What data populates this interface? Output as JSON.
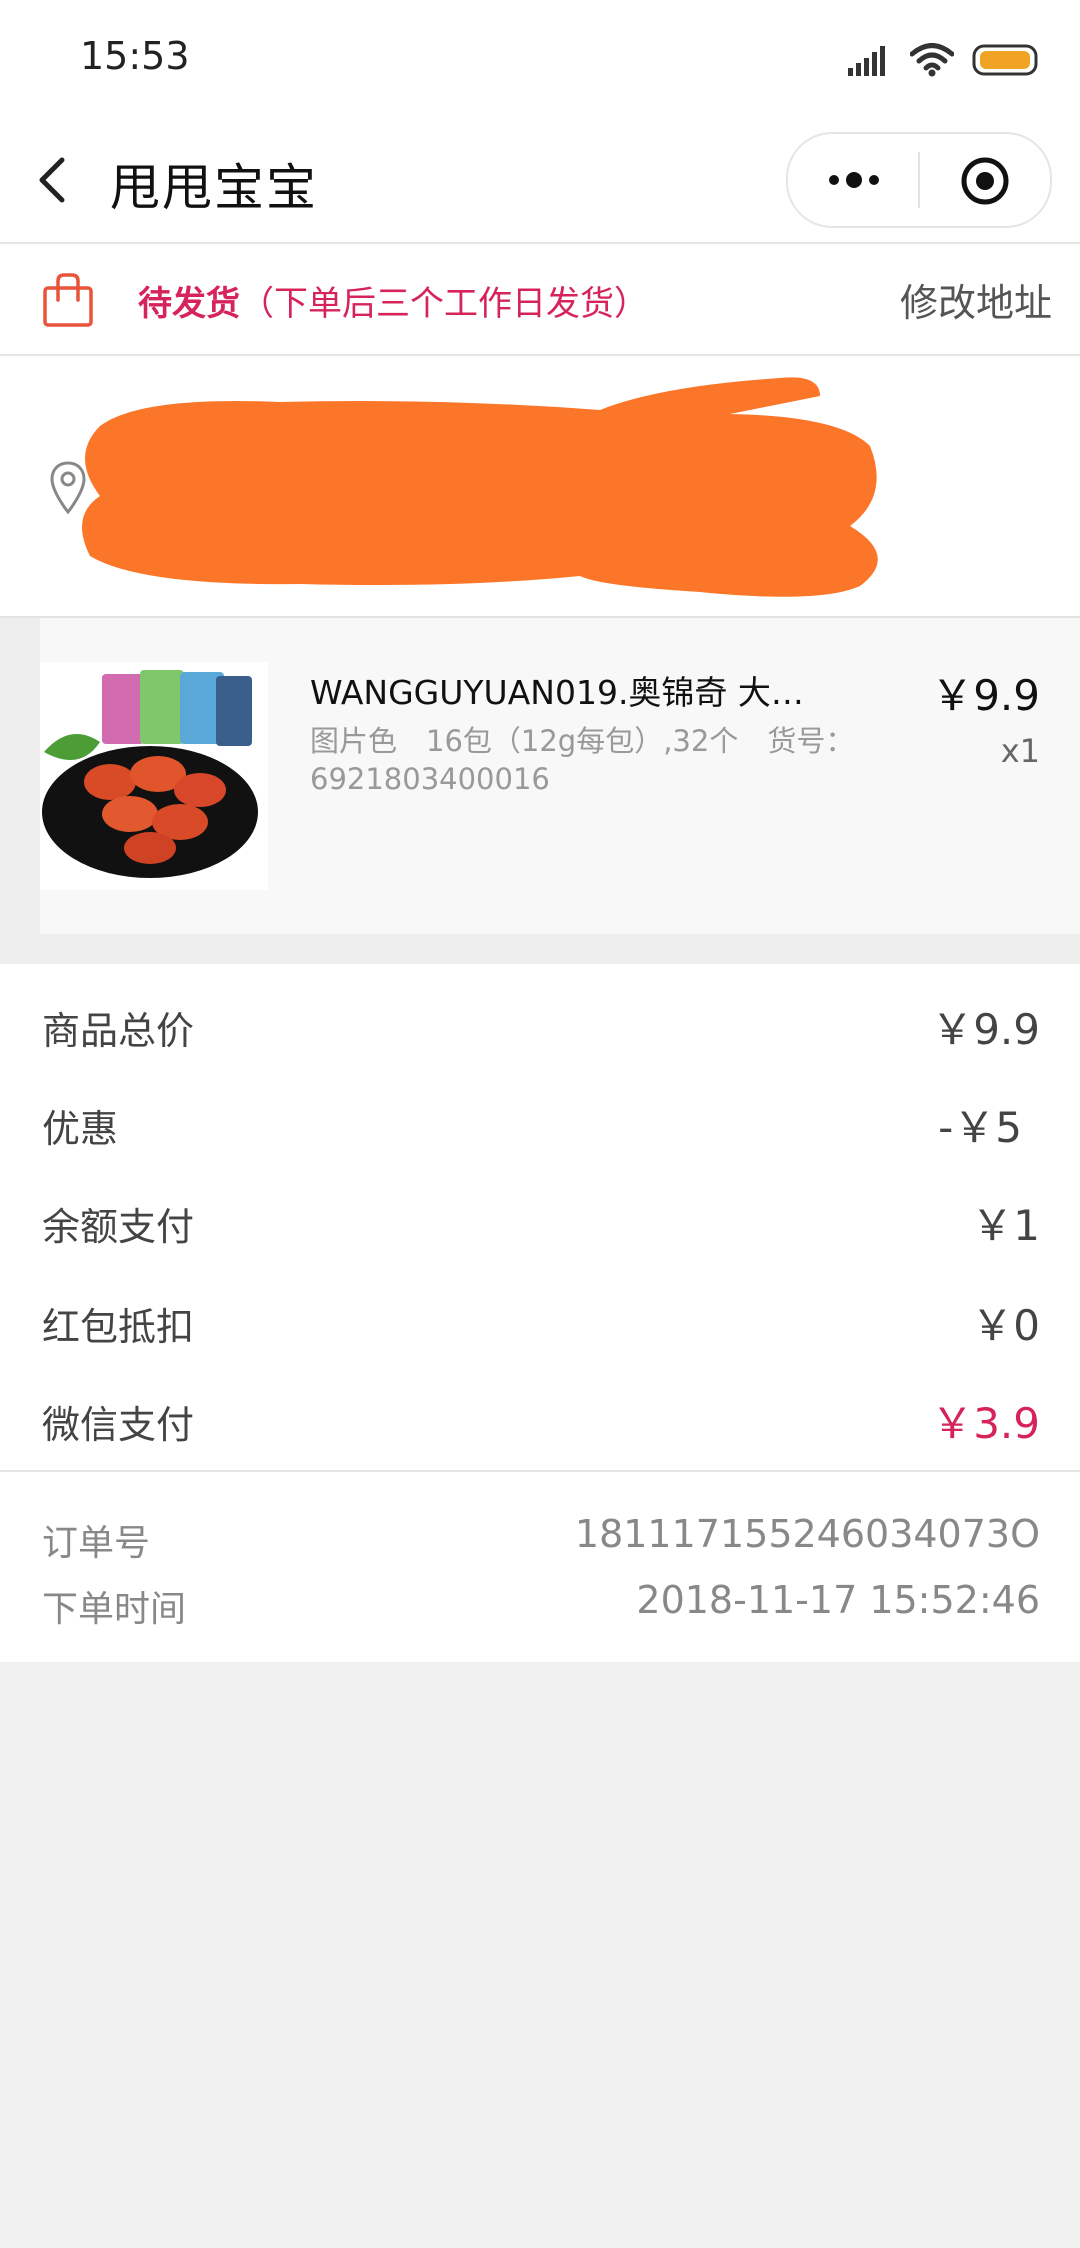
{
  "status_bar": {
    "time": "15:53"
  },
  "nav": {
    "title": "甩甩宝宝"
  },
  "order_status": {
    "status_main": "待发货",
    "status_note": "（下单后三个工作日发货）",
    "modify_address": "修改地址"
  },
  "product": {
    "title": "WANGGUYUAN019.奥锦奇 大拇...",
    "spec_line1": "图片色　16包（12g每包）,32个　货号：",
    "spec_line2": "6921803400016",
    "price": "￥9.9",
    "quantity": "x1"
  },
  "summary": {
    "rows": [
      {
        "label": "商品总价",
        "value": "￥9.9"
      },
      {
        "label": "优惠",
        "value": "-￥5"
      },
      {
        "label": "余额支付",
        "value": "￥1"
      },
      {
        "label": "红包抵扣",
        "value": "￥0"
      },
      {
        "label": "微信支付",
        "value": "￥3.9"
      }
    ]
  },
  "order_info": {
    "order_no_label": "订单号",
    "order_no": "181117155246034073O",
    "order_time_label": "下单时间",
    "order_time": "2018-11-17 15:52:46"
  },
  "colors": {
    "accent_pink": "#d6245a",
    "redaction_orange": "#fb7629",
    "battery": "#f1a325"
  }
}
